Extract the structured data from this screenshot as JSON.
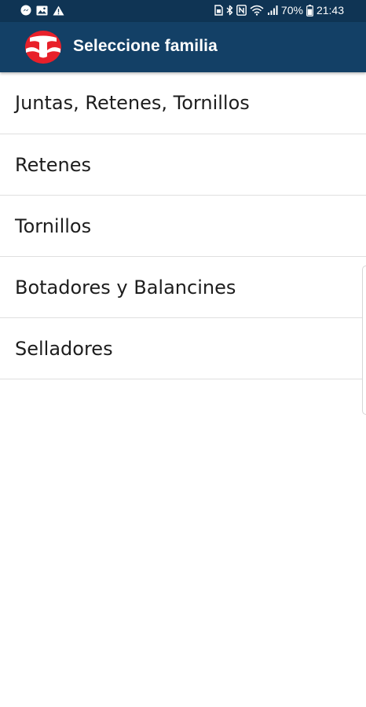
{
  "status_bar": {
    "battery_percent": "70%",
    "time": "21:43",
    "left_icons": [
      "messenger-icon",
      "gallery-icon",
      "warning-icon"
    ],
    "right_icons": [
      "sim-card-icon",
      "bluetooth-icon",
      "nfc-icon",
      "wifi-icon",
      "signal-icon",
      "battery-icon"
    ]
  },
  "app_bar": {
    "title": "Seleccione familia",
    "logo": "brand-logo",
    "colors": {
      "status_bar": "#0f3454",
      "app_bar": "#134066",
      "logo_red": "#e8202a"
    }
  },
  "families": {
    "items": [
      {
        "label": "Juntas, Retenes, Tornillos"
      },
      {
        "label": "Retenes"
      },
      {
        "label": "Tornillos"
      },
      {
        "label": "Botadores y Balancines"
      },
      {
        "label": "Selladores"
      }
    ]
  }
}
